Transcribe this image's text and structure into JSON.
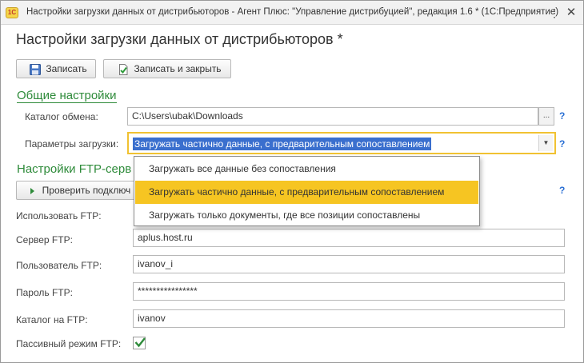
{
  "window": {
    "logo_text": "1C",
    "title": "Настройки загрузки данных от дистрибьюторов - Агент Плюс: \"Управление дистрибуцией\", редакция 1.6 * (1С:Предприятие)",
    "menu_glyph": "⋮",
    "close_glyph": "✕"
  },
  "page": {
    "title": "Настройки загрузки данных от дистрибьюторов *"
  },
  "toolbar": {
    "save_label": "Записать",
    "save_close_label": "Записать и закрыть"
  },
  "general": {
    "section_title": "Общие настройки",
    "catalog_label": "Каталог обмена:",
    "catalog_value": "C:\\Users\\ubak\\Downloads",
    "dots_label": "...",
    "params_label": "Параметры загрузки:",
    "params_value": "Загружать частично данные, с предварительным сопоставлением",
    "help": "?"
  },
  "dropdown": {
    "options": [
      "Загружать все данные без сопоставления",
      "Загружать частично данные, с предварительным сопоставлением",
      "Загружать только документы, где все позиции сопоставлены"
    ],
    "selected_index": 1
  },
  "ftp": {
    "section_title": "Настройки FTP-серв",
    "check_button_label": "Проверить подключ",
    "use_label": "Использовать FTP:",
    "server_label": "Сервер FTP:",
    "server_value": "aplus.host.ru",
    "user_label": "Пользователь FTP:",
    "user_value": "ivanov_i",
    "password_label": "Пароль FTP:",
    "password_value": "****************",
    "catalog_label": "Каталог на FTP:",
    "catalog_value": "ivanov",
    "passive_label": "Пассивный режим FTP:",
    "passive_checked": true,
    "help": "?"
  },
  "colors": {
    "accent_green": "#2e8b3a",
    "selection_yellow": "#f6c522",
    "combo_border": "#f1c232",
    "selection_blue": "#3a6fce",
    "help_blue": "#2a6fd4"
  }
}
